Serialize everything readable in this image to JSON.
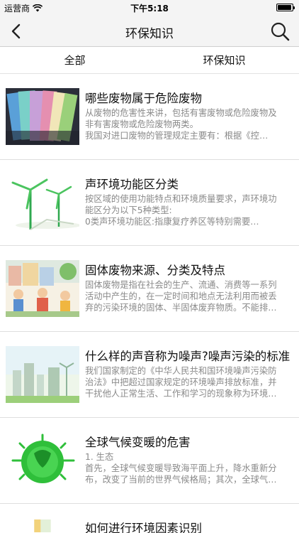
{
  "status": {
    "carrier": "运营商",
    "time": "下午5:18"
  },
  "nav": {
    "title": "环保知识"
  },
  "tabs": [
    {
      "label": "全部"
    },
    {
      "label": "环保知识"
    }
  ],
  "items": [
    {
      "title": "哪些废物属于危险废物",
      "lines": [
        "从废物的危害性来讲，包括有害废物或危险废物及",
        "非有害废物或危险废物两类。",
        "    我国对进口废物的管理规定主要有：根据《控…"
      ],
      "thumb_icon": "colored-paper-swatches-image"
    },
    {
      "title": "声环境功能区分类",
      "lines": [
        "按区域的使用功能特点和环境质量要求，声环境功",
        "能区分为以下5种类型:",
        "    0类声环境功能区:指康复疗养区等特别需要…"
      ],
      "thumb_icon": "wind-turbines-image"
    },
    {
      "title": "固体废物来源、分类及特点",
      "lines": [
        "固体废物是指在社会的生产、流通、消费等一系列",
        "活动中产生的，在一定时间和地点无法利用而被丢",
        "弃的污染环境的固体、半固体废弃物质。不能排…"
      ],
      "thumb_icon": "children-cleaning-image"
    },
    {
      "title": "什么样的声音称为噪声?噪声污染的标准",
      "lines": [
        "我们国家制定的《中华人民共和国环境噪声污染防",
        "治法》中把超过国家规定的环境噪声排放标准，并",
        "干扰他人正常生活、工作和学习的现象称为环境…"
      ],
      "thumb_icon": "green-city-image"
    },
    {
      "title": "全球气候变暖的危害",
      "lines": [
        "1. 生态",
        "首先，全球气候变暖导致海平面上升，降水重新分",
        "布，改变了当前的世界气候格局；其次，全球气…"
      ],
      "thumb_icon": "green-globe-image"
    },
    {
      "title": "如何进行环境因素识别",
      "lines": [],
      "thumb_icon": "partial-thumbnail-image"
    }
  ]
}
